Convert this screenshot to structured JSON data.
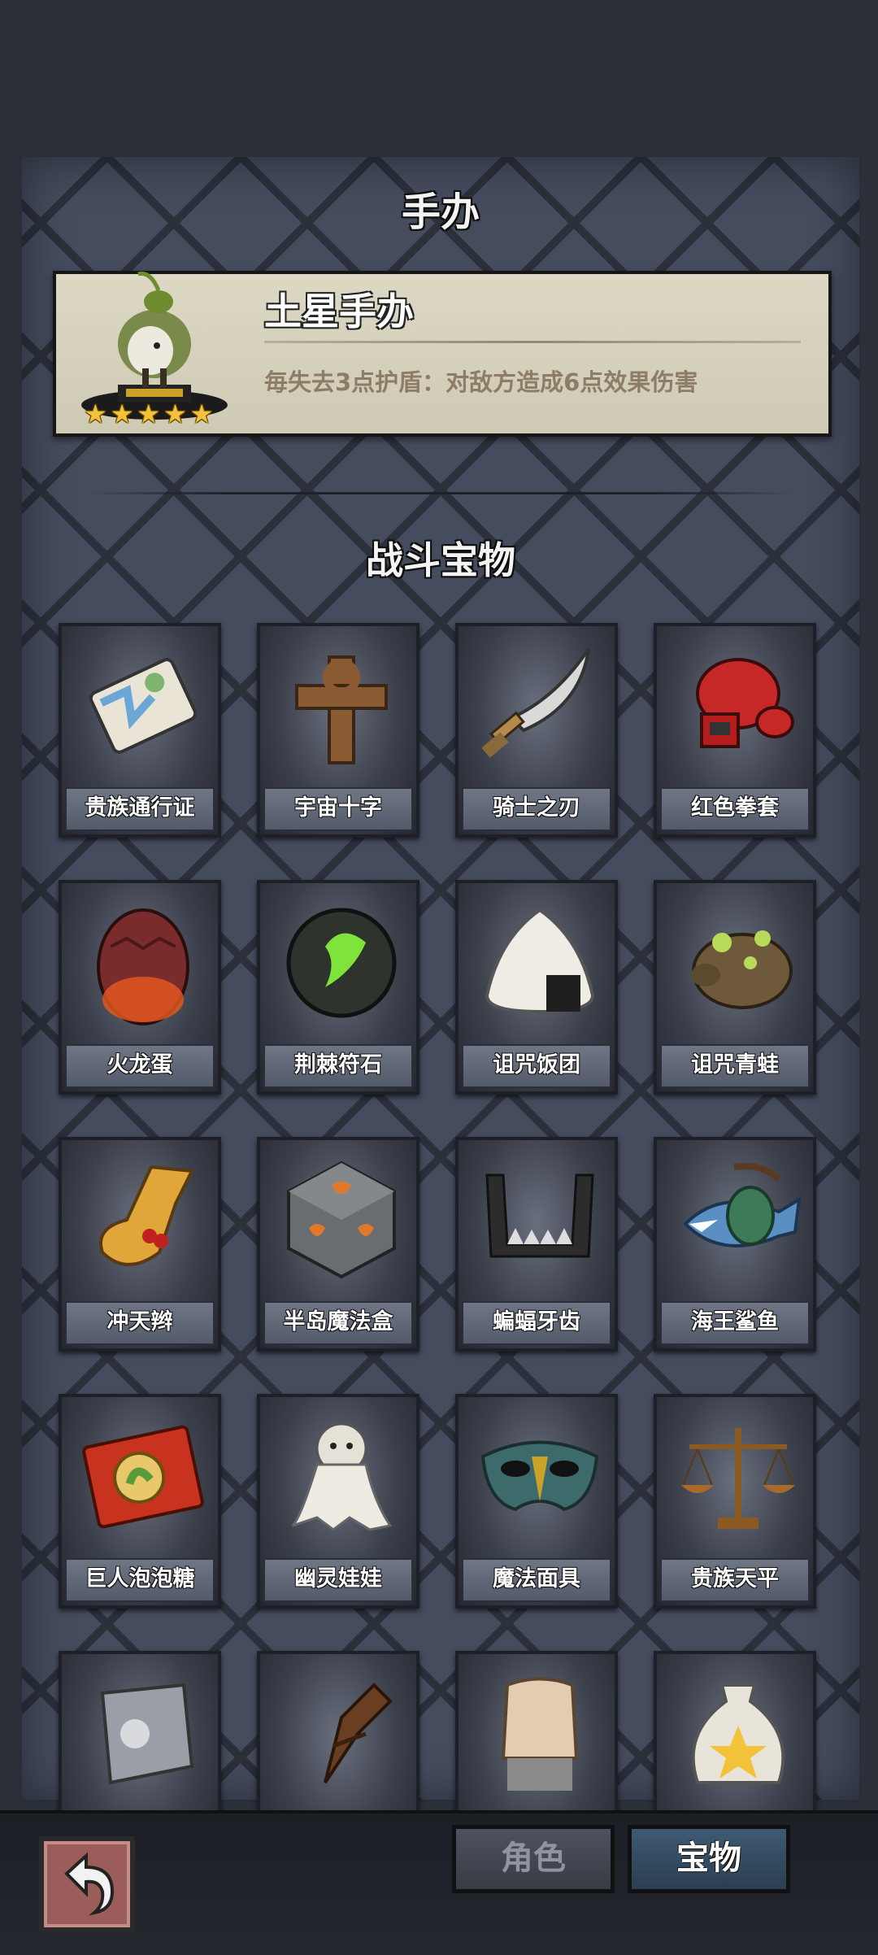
{
  "figure_section": {
    "title": "手办",
    "figure": {
      "name": "土星手办",
      "description": "毎失去3点护盾：对敌方造成6点效果伤害",
      "stars": 5
    }
  },
  "battle_section": {
    "title": "战斗宝物",
    "items": [
      {
        "label": "贵族通行证",
        "icon": "pass-card-icon"
      },
      {
        "label": "宇宙十字",
        "icon": "wooden-cross-icon"
      },
      {
        "label": "骑士之刃",
        "icon": "knife-icon"
      },
      {
        "label": "红色拳套",
        "icon": "boxing-glove-icon"
      },
      {
        "label": "火龙蛋",
        "icon": "dragon-egg-icon"
      },
      {
        "label": "荆棘符石",
        "icon": "rune-stone-icon"
      },
      {
        "label": "诅咒饭团",
        "icon": "rice-ball-icon"
      },
      {
        "label": "诅咒青蛙",
        "icon": "frog-icon"
      },
      {
        "label": "冲天辫",
        "icon": "ponytail-icon"
      },
      {
        "label": "半岛魔法盒",
        "icon": "magic-cube-icon"
      },
      {
        "label": "蝙蝠牙齿",
        "icon": "bat-teeth-icon"
      },
      {
        "label": "海王鲨鱼",
        "icon": "shark-icon"
      },
      {
        "label": "巨人泡泡糖",
        "icon": "bubblegum-icon"
      },
      {
        "label": "幽灵娃娃",
        "icon": "ghost-doll-icon"
      },
      {
        "label": "魔法面具",
        "icon": "mask-icon"
      },
      {
        "label": "贵族天平",
        "icon": "scales-icon"
      },
      {
        "label": "",
        "icon": "armor-icon"
      },
      {
        "label": "",
        "icon": "wooden-club-icon"
      },
      {
        "label": "",
        "icon": "fist-icon"
      },
      {
        "label": "",
        "icon": "sack-icon"
      }
    ]
  },
  "tabs": {
    "role": "角色",
    "treasure": "宝物"
  },
  "back_icon": "back-arrow-icon",
  "colors": {
    "accent": "#2b3e52",
    "star": "#f2c23a",
    "back": "#9b5d5a"
  }
}
